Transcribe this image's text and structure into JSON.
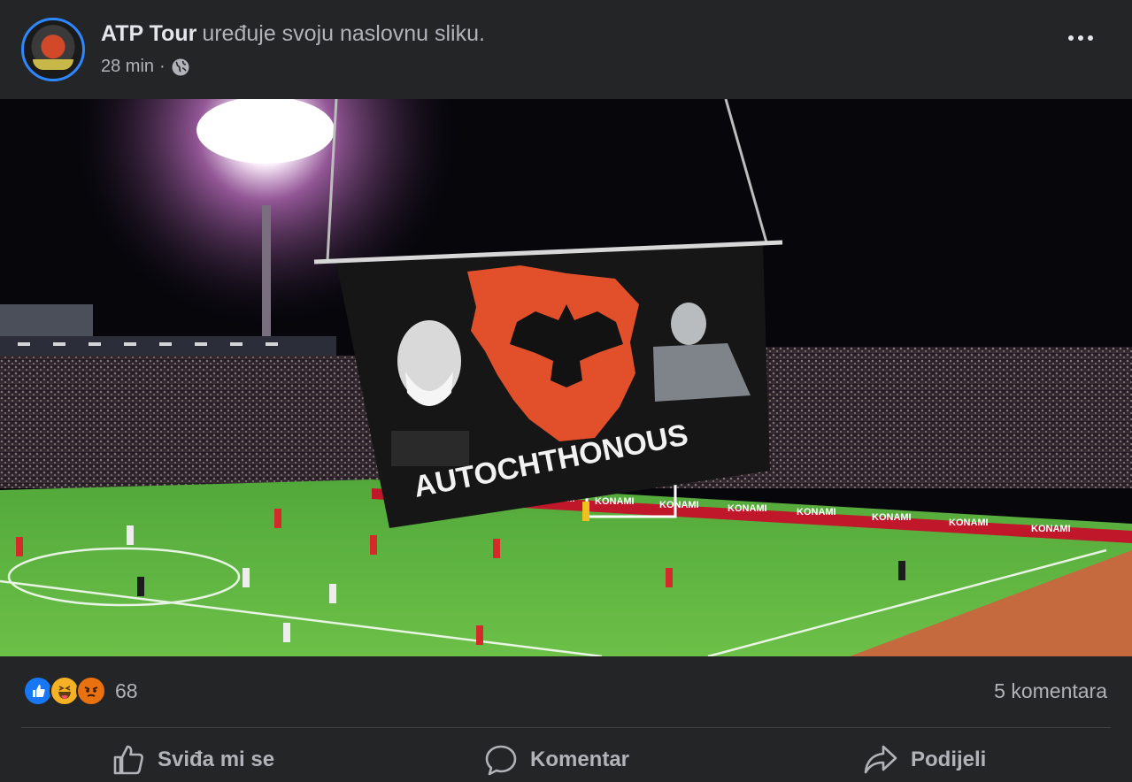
{
  "post": {
    "author": "ATP Tour",
    "action_text": "uređuje svoju naslovnu sliku.",
    "time": "28 min",
    "audience_icon": "globe-icon",
    "more_icon": "more-options-icon"
  },
  "photo": {
    "banner_text": "AUTOCHTHONOUS",
    "board_text": "KONAMI"
  },
  "stats": {
    "reaction_icons": [
      "like-icon",
      "haha-icon",
      "angry-icon"
    ],
    "reaction_count": "68",
    "comments": "5 komentara"
  },
  "actions": {
    "like": "Sviđa mi se",
    "comment": "Komentar",
    "share": "Podijeli"
  },
  "colors": {
    "background": "#242526",
    "primary_text": "#e4e6eb",
    "secondary_text": "#b0b3b8",
    "accent": "#1877f2",
    "banner_red": "#e2502b"
  }
}
